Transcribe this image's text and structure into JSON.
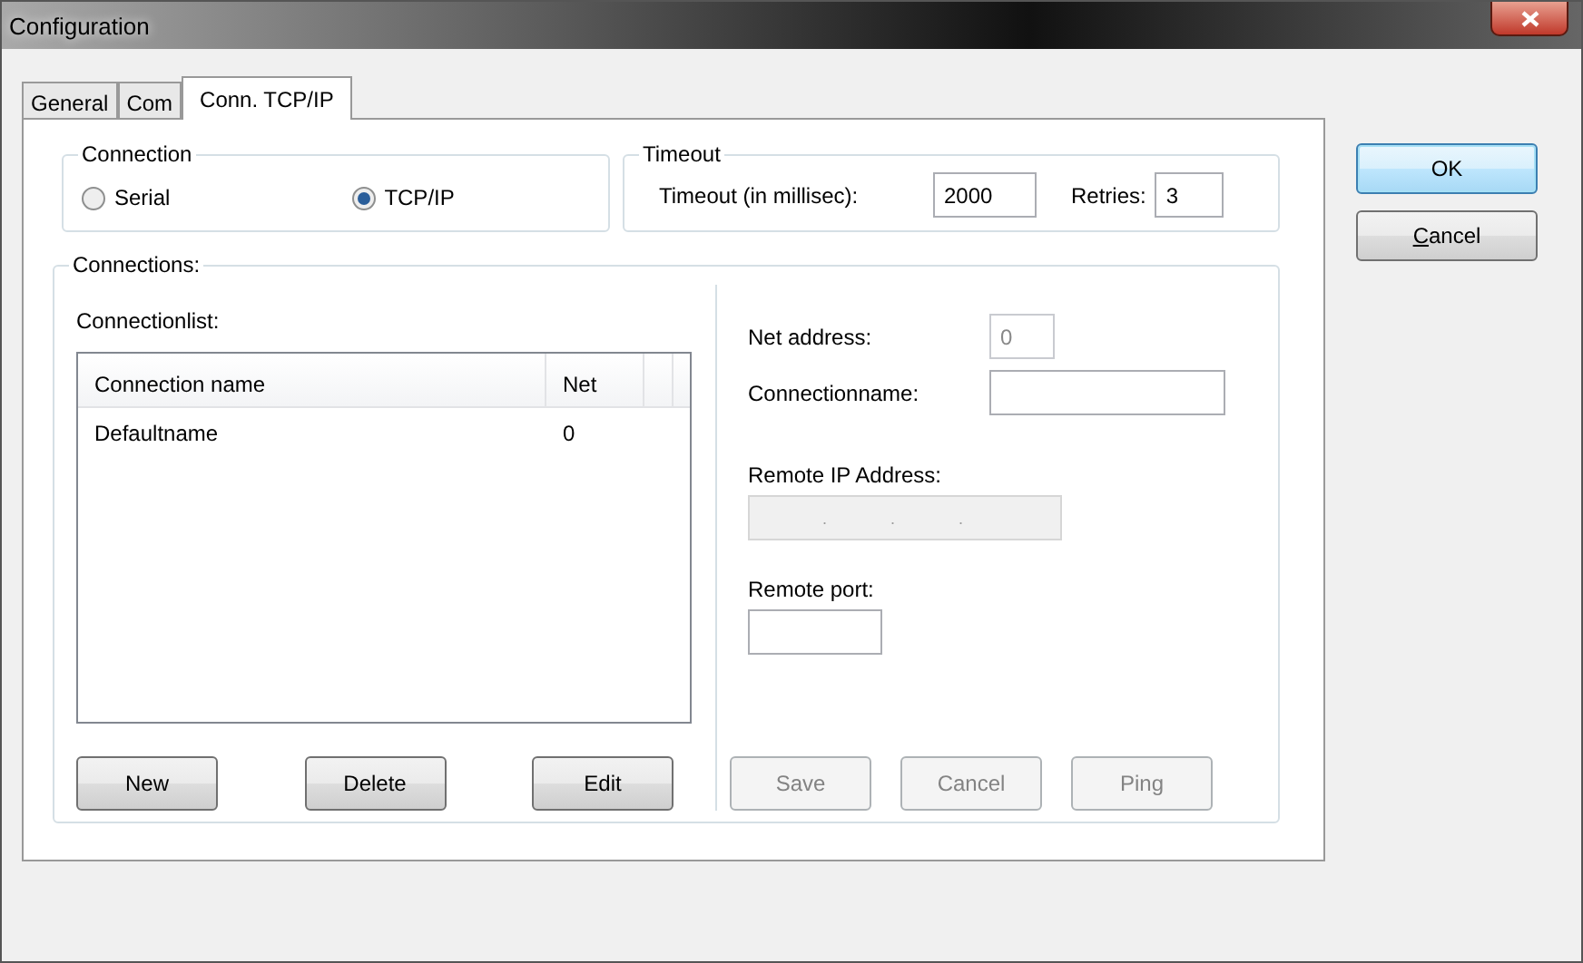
{
  "window": {
    "title": "Configuration"
  },
  "tabs": [
    {
      "label": "General",
      "selected": false
    },
    {
      "label": "Com",
      "selected": false
    },
    {
      "label": "Conn. TCP/IP",
      "selected": true
    }
  ],
  "connection": {
    "title": "Connection",
    "options": [
      {
        "label": "Serial",
        "selected": false
      },
      {
        "label": "TCP/IP",
        "selected": true
      }
    ]
  },
  "timeout": {
    "title": "Timeout",
    "timeout_label": "Timeout (in millisec):",
    "timeout_value": "2000",
    "retries_label": "Retries:",
    "retries_value": "3"
  },
  "connections": {
    "title": "Connections:",
    "list_label": "Connectionlist:",
    "columns": [
      "Connection name",
      "Net"
    ],
    "rows": [
      {
        "cells": [
          "Defaultname",
          "0"
        ],
        "selected": false
      }
    ],
    "list_buttons": [
      {
        "label": "New",
        "disabled": false
      },
      {
        "label": "Delete",
        "disabled": false
      },
      {
        "label": "Edit",
        "disabled": false
      }
    ],
    "net_address": {
      "label": "Net address:",
      "value": "0",
      "disabled": true
    },
    "connection_name": {
      "label": "Connectionname:",
      "disabled": false
    },
    "remote_ip": {
      "label": "Remote IP Address:",
      "dots": [
        ".",
        ".",
        "."
      ],
      "disabled": true
    },
    "remote_port": {
      "label": "Remote port:",
      "disabled": false
    },
    "edit_buttons": [
      {
        "label": "Save",
        "disabled": true
      },
      {
        "label": "Cancel",
        "disabled": true
      },
      {
        "label": "Ping",
        "disabled": true
      }
    ]
  },
  "dialog_buttons": [
    {
      "label": "OK",
      "default": true,
      "first_letter_underlined": false
    },
    {
      "label": "Cancel",
      "default": false,
      "first_letter_underlined": true
    }
  ]
}
